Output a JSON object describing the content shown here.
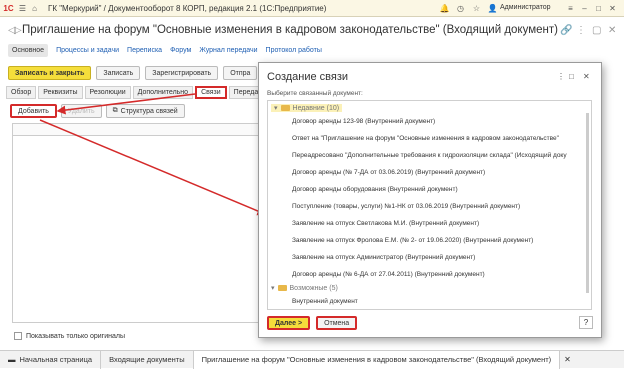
{
  "titlebar": {
    "title": "ГК \"Меркурий\" / Документооборот 8 КОРП, редакция 2.1  (1С:Предприятие)",
    "user": "Администратор"
  },
  "doc": {
    "title": "Приглашение на форум \"Основные изменения в кадровом законодательстве\" (Входящий документ)"
  },
  "navlinks": {
    "main": "Основное",
    "l1": "Процессы и задачи",
    "l2": "Переписка",
    "l3": "Форум",
    "l4": "Журнал передачи",
    "l5": "Протокол работы"
  },
  "cmd": {
    "save_close": "Записать и закрыть",
    "save": "Записать",
    "register": "Зарегистрировать",
    "send": "Отпра"
  },
  "tabs": {
    "t1": "Обзор",
    "t2": "Реквизиты",
    "t3": "Резолюции",
    "t4": "Дополнительно",
    "t5": "Связи",
    "t6": "Передачи"
  },
  "sub": {
    "add": "Добавить",
    "delete": "Удалить",
    "structure": "Структура связей"
  },
  "show_originals": "Показывать только оригиналы",
  "bottom": {
    "home": "Начальная страница",
    "incoming": "Входящие документы",
    "current": "Приглашение на форум \"Основные изменения в кадровом законодательстве\" (Входящий документ)"
  },
  "dialog": {
    "title": "Создание связи",
    "hint": "Выберите связанный документ:",
    "group_recent": "Недавние (10)",
    "recent": [
      "Договор аренды 123-98 (Внутренний документ)",
      "Ответ на \"Приглашение на форум \"Основные изменения в кадровом законодательстве\"",
      "Переадресовано \"Дополнительные требования к гидроизоляции склада\" (Исходящий доку",
      "Договор аренды (№ 7-ДА от 03.06.2019) (Внутренний документ)",
      "Договор аренды оборудования (Внутренний документ)",
      "Поступление (товары, услуги) №1-НК от 03.06.2019 (Внутренний документ)",
      "Заявление на отпуск Светлакова М.И. (Внутренний документ)",
      "Заявление на отпуск Фролова Е.М. (№ 2- от 19.06.2020) (Внутренний документ)",
      "Заявление на отпуск Администратор (Внутренний документ)",
      "Договор аренды (№ 6-ДА от 27.04.2011) (Внутренний документ)"
    ],
    "group_possible": "Возможные (5)",
    "possible": [
      "Внутренний документ"
    ],
    "next": "Далее >",
    "cancel": "Отмена",
    "help": "?"
  },
  "colors": {
    "accent": "#f5de3b",
    "highlight": "#d42a2a"
  }
}
